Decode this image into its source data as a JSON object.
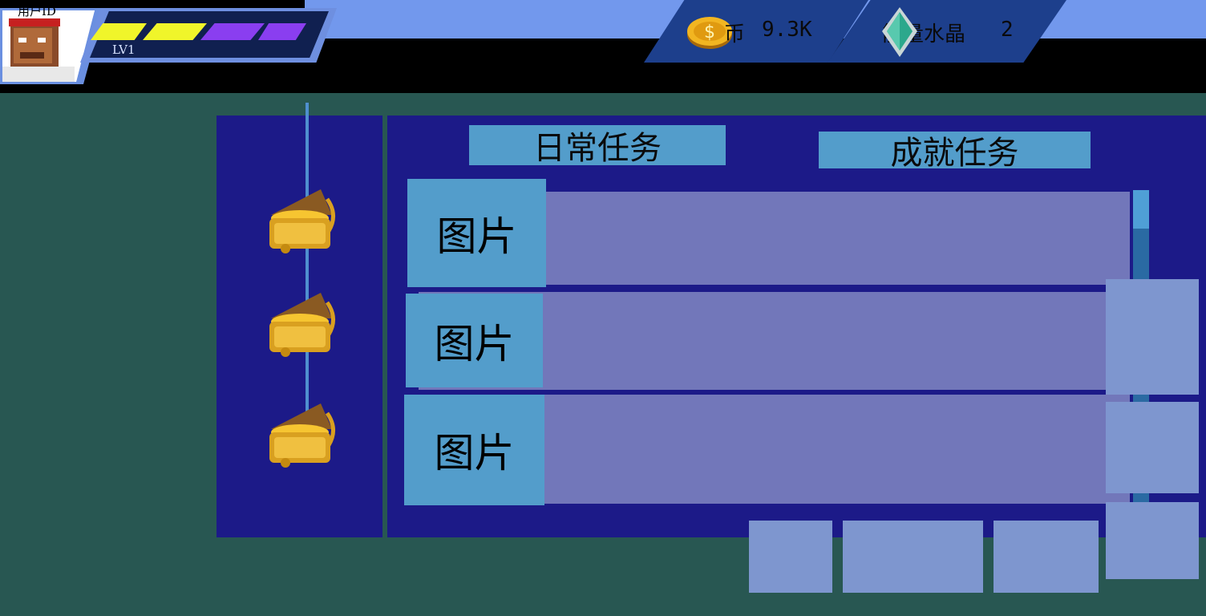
{
  "user": {
    "id_label": "用户ID",
    "level": "LV1",
    "xp_segments": [
      "#f0f52a",
      "#f0f52a",
      "#8a3ef0",
      "#8a3ef0"
    ]
  },
  "resources": {
    "coin": {
      "label": "币",
      "value": "9.3K",
      "icon": "gold-coin-icon"
    },
    "crystal": {
      "label": "能量水晶",
      "value": "2",
      "icon": "crystal-icon"
    }
  },
  "tabs": {
    "daily": "日常任务",
    "achievement": "成就任务"
  },
  "tasks": [
    {
      "thumb": "图片"
    },
    {
      "thumb": "图片"
    },
    {
      "thumb": "图片"
    }
  ],
  "rewards": [
    {
      "icon": "treasure-chest-icon"
    },
    {
      "icon": "treasure-chest-icon"
    },
    {
      "icon": "treasure-chest-icon"
    }
  ],
  "colors": {
    "background": "#285752",
    "panel": "#1c1a88",
    "tab": "#539dcb",
    "row": "#7277ba",
    "box": "#7e96cf"
  }
}
